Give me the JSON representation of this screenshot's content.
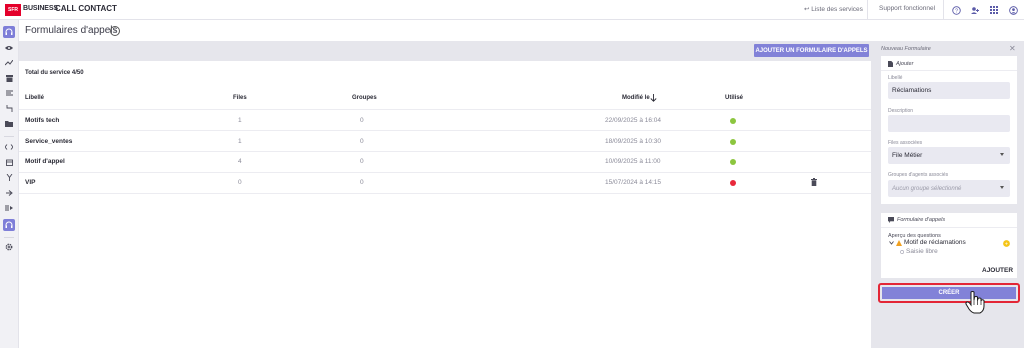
{
  "header": {
    "logo_text": "SFR",
    "brand": "BUSINESS",
    "app_name": "CALL CONTACT",
    "services_link": "↩ Liste des services",
    "support_link": "Support fonctionnel",
    "icons": [
      "help-icon",
      "users-icon",
      "apps-grid-icon",
      "account-icon"
    ]
  },
  "sidebar": {
    "icons": [
      "headset-icon",
      "eye-icon",
      "trend-icon",
      "archive-icon",
      "list-icon",
      "route-icon",
      "folder-icon",
      "code-icon",
      "calendar-icon",
      "branch-icon",
      "forward-icon",
      "queue-icon",
      "headset-icon",
      "settings-icon"
    ]
  },
  "page": {
    "title": "Formulaires d'appels",
    "add_button": "AJOUTER UN FORMULAIRE D'APPELS",
    "total": "Total du service 4/50"
  },
  "table": {
    "columns": {
      "libelle": "Libellé",
      "files": "Files",
      "groupes": "Groupes",
      "modifie": "Modifié le",
      "utilise": "Utilisé"
    },
    "rows": [
      {
        "name": "Motifs tech",
        "files": "1",
        "groupes": "0",
        "modified": "22/09/2025 à 16:04",
        "status": "green"
      },
      {
        "name": "Service_ventes",
        "files": "1",
        "groupes": "0",
        "modified": "18/09/2025 à 10:30",
        "status": "green"
      },
      {
        "name": "Motif d'appel",
        "files": "4",
        "groupes": "0",
        "modified": "10/09/2025 à 11:00",
        "status": "green"
      },
      {
        "name": "VIP",
        "files": "0",
        "groupes": "0",
        "modified": "15/07/2024 à 14:15",
        "status": "red"
      }
    ]
  },
  "panel": {
    "title": "Nouveau Formulaire",
    "section_add": "Ajouter",
    "libelle_label": "Libellé",
    "libelle_value": "Réclamations",
    "description_label": "Description",
    "description_value": "",
    "files_label": "Files associées",
    "files_value": "File Métier",
    "groups_label": "Groupes d'agents associés",
    "groups_value": "Aucun groupe sélectionné",
    "section_form": "Formulaire d'appels",
    "questions_label": "Aperçu des questions",
    "question_1": "Motif de réclamations",
    "question_1_sub": "Saisie libre",
    "add_link": "AJOUTER",
    "create_button": "CRÉER"
  },
  "colors": {
    "accent": "#8282d8",
    "green": "#8cc63f",
    "red": "#e8293b",
    "highlight": "#e32636"
  }
}
